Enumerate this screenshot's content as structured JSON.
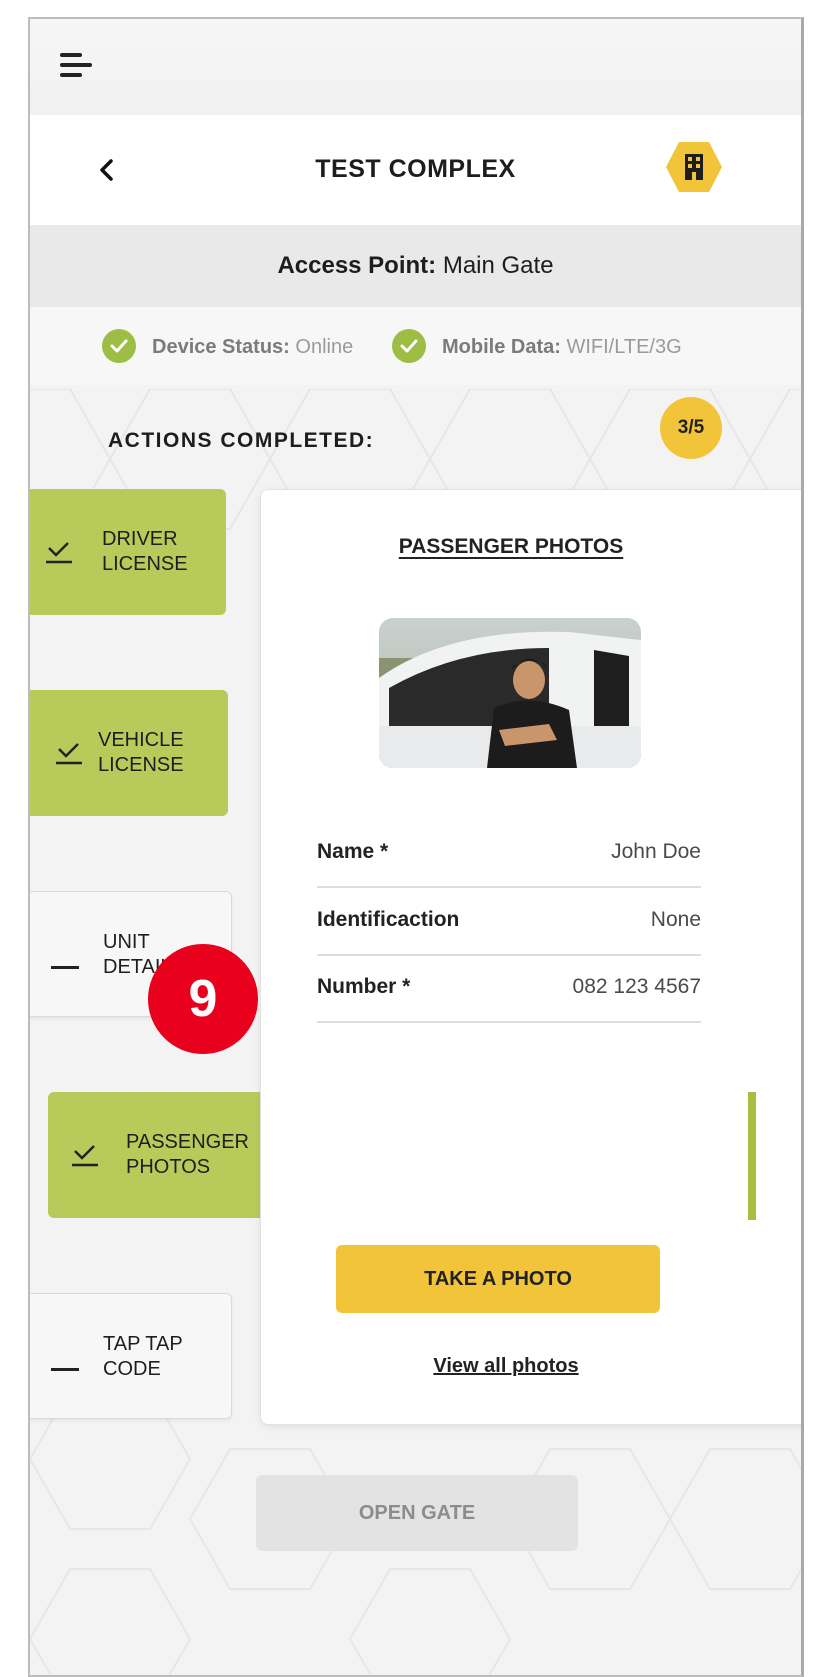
{
  "topbar": {
    "menu_icon": "hamburger-menu-icon"
  },
  "header": {
    "title": "TEST COMPLEX",
    "back_icon": "chevron-left-icon",
    "badge_icon": "building-icon",
    "badge_color": "#f2c43a"
  },
  "access_point": {
    "label": "Access Point:",
    "value": "Main Gate"
  },
  "status": {
    "device": {
      "label": "Device Status:",
      "value": "Online"
    },
    "mobile": {
      "label": "Mobile Data:",
      "value": "WIFI/LTE/3G"
    },
    "ok_color": "#9dbd45"
  },
  "actions": {
    "label": "ACTIONS COMPLETED:",
    "count": "3/5",
    "items": [
      {
        "line1": "DRIVER",
        "line2": "LICENSE",
        "done": true
      },
      {
        "line1": "VEHICLE",
        "line2": "LICENSE",
        "done": true
      },
      {
        "line1": "UNIT",
        "line2": "DETAILS",
        "done": false
      },
      {
        "line1": "PASSENGER",
        "line2": "PHOTOS",
        "done": true
      },
      {
        "line1": "TAP TAP",
        "line2": "CODE",
        "done": false
      }
    ],
    "done_color": "#b8cb5a"
  },
  "card": {
    "title": "PASSENGER PHOTOS",
    "fields": [
      {
        "label": "Name *",
        "value": "John Doe"
      },
      {
        "label": "Identificaction",
        "value": "None"
      },
      {
        "label": "Number *",
        "value": "082 123 4567"
      }
    ],
    "take_photo": "TAKE A PHOTO",
    "view_all": "View all photos",
    "accent": "#f2c43a"
  },
  "open_gate": "OPEN GATE",
  "step_marker": "9",
  "marker_color": "#e8001c"
}
